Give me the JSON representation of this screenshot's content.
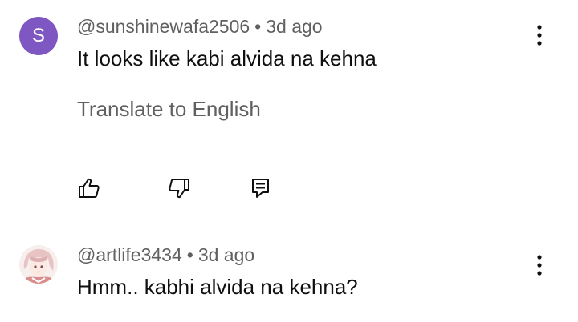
{
  "comments": [
    {
      "avatar_letter": "S",
      "avatar_color": "#7e57c2",
      "author": "@sunshinewafa2506",
      "separator": "•",
      "time": "3d ago",
      "text": "It looks like kabi alvida na kehna",
      "translate_label": "Translate to English",
      "actions": [
        "thumb-up-icon",
        "thumb-down-icon",
        "reply-icon"
      ],
      "menu_icon": "more-vert-icon"
    },
    {
      "avatar_image": "anime-character-avatar",
      "author": "@artlife3434",
      "separator": "•",
      "time": "3d ago",
      "text": "Hmm.. kabhi alvida na kehna?",
      "menu_icon": "more-vert-icon"
    }
  ]
}
